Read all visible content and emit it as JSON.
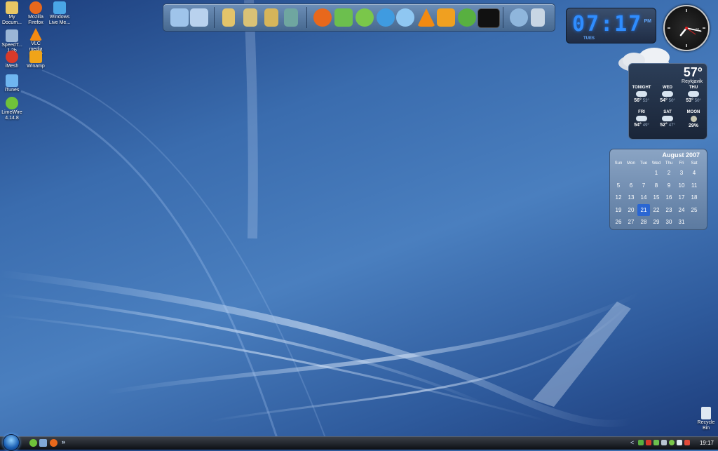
{
  "desktop_icons": [
    {
      "label": "My Docum...",
      "icon": "folder-documents-icon",
      "color": "#e9c764"
    },
    {
      "label": "Mozilla Firefox",
      "icon": "firefox-icon",
      "color": "#e8681c"
    },
    {
      "label": "Windows Live Me...",
      "icon": "messenger-icon",
      "color": "#4aa6e6"
    },
    {
      "label": "SpeedT... 1.2b",
      "icon": "speedtest-icon",
      "color": "#9bb6d6"
    },
    {
      "label": "VLC media player",
      "icon": "vlc-icon",
      "color": "#f28a12"
    },
    {
      "label": "iMesh",
      "icon": "imesh-icon",
      "color": "#d83a2a"
    },
    {
      "label": "Winamp",
      "icon": "winamp-icon",
      "color": "#f0a418"
    },
    {
      "label": "iTunes",
      "icon": "itunes-icon",
      "color": "#6fb6f0"
    },
    {
      "label": "LimeWire 4.14.8",
      "icon": "limewire-icon",
      "color": "#6fc23a"
    }
  ],
  "dock": {
    "icons": [
      {
        "name": "computer-icon",
        "color": "#9fc4ea"
      },
      {
        "name": "network-icon",
        "color": "#b9d2ee"
      },
      {
        "name": "folder-icon",
        "color": "#e3c46a"
      },
      {
        "name": "documents-folder-icon",
        "color": "#d9c276"
      },
      {
        "name": "music-folder-icon",
        "color": "#d6b55a"
      },
      {
        "name": "pictures-folder-icon",
        "color": "#6fa6a0"
      },
      {
        "name": "firefox-icon",
        "color": "#e8681c"
      },
      {
        "name": "messenger-icon",
        "color": "#6cbf4e"
      },
      {
        "name": "limewire-icon",
        "color": "#7ac74a"
      },
      {
        "name": "globe-icon",
        "color": "#3f9be0"
      },
      {
        "name": "itunes-icon",
        "color": "#8fc7f2"
      },
      {
        "name": "vlc-icon",
        "color": "#f28a12"
      },
      {
        "name": "media-player-icon",
        "color": "#f0a020"
      },
      {
        "name": "utorrent-icon",
        "color": "#58b040"
      },
      {
        "name": "steam-icon",
        "color": "#111111"
      },
      {
        "name": "gear-icon",
        "color": "#8fb6dc"
      },
      {
        "name": "recycle-bin-icon",
        "color": "#c8d6e4"
      }
    ]
  },
  "digital_clock": {
    "time": "07:17",
    "ampm": "PM",
    "day": "TUES"
  },
  "analog_clock": {
    "hour": 7,
    "minute": 17,
    "date": "21"
  },
  "weather": {
    "temp": "57°",
    "city": "Reykjavik",
    "forecast": [
      {
        "label": "TONIGHT",
        "high": "56°",
        "low": "53°"
      },
      {
        "label": "WED",
        "high": "54°",
        "low": "50°"
      },
      {
        "label": "THU",
        "high": "53°",
        "low": "50°"
      },
      {
        "label": "FRI",
        "high": "54°",
        "low": "49°"
      },
      {
        "label": "SAT",
        "high": "52°",
        "low": "47°"
      },
      {
        "label": "MOON",
        "high": "29%",
        "low": ""
      }
    ]
  },
  "calendar": {
    "title": "August 2007",
    "weekdays": [
      "Sun",
      "Mon",
      "Tue",
      "Wed",
      "Thu",
      "Fri",
      "Sat"
    ],
    "weeks": [
      [
        "",
        "",
        "",
        "1",
        "2",
        "3",
        "4"
      ],
      [
        "5",
        "6",
        "7",
        "8",
        "9",
        "10",
        "11"
      ],
      [
        "12",
        "13",
        "14",
        "15",
        "16",
        "17",
        "18"
      ],
      [
        "19",
        "20",
        "21",
        "22",
        "23",
        "24",
        "25"
      ],
      [
        "26",
        "27",
        "28",
        "29",
        "30",
        "31",
        ""
      ]
    ],
    "today": "21"
  },
  "recycle_bin": {
    "label": "Recycle Bin"
  },
  "taskbar": {
    "more_glyph": "»",
    "tray_arrow": "<",
    "clock": "19:17"
  }
}
